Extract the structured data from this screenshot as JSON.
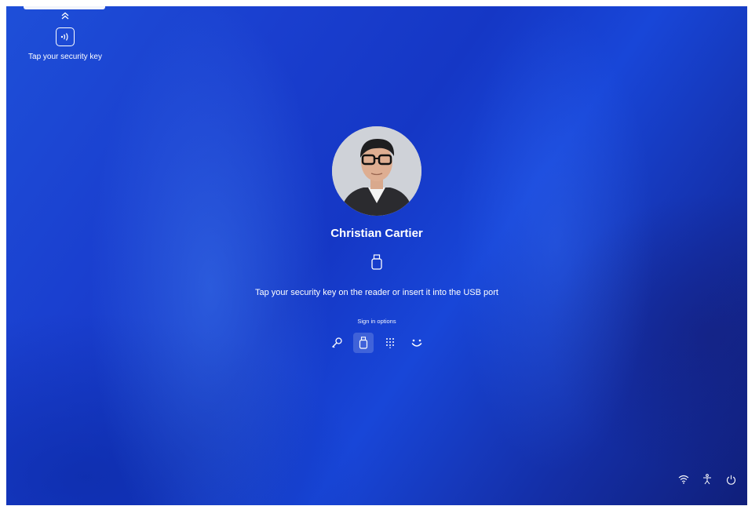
{
  "notification": {
    "label": "Tap your security key",
    "icons": {
      "expand": "chevron-double-up-icon",
      "key": "nfc-security-key-icon"
    }
  },
  "user": {
    "name": "Christian Cartier",
    "avatar_icon": "user-photo-avatar"
  },
  "prompt": {
    "icon": "usb-security-key-icon",
    "text": "Tap your security key on the reader or insert it into the USB port"
  },
  "sign_in": {
    "label": "Sign in options",
    "options": [
      {
        "icon": "key-icon",
        "selected": false
      },
      {
        "icon": "usb-key-icon",
        "selected": true
      },
      {
        "icon": "pin-keypad-icon",
        "selected": false
      },
      {
        "icon": "face-recognition-icon",
        "selected": false
      }
    ]
  },
  "tray": {
    "icons": [
      "wifi-icon",
      "accessibility-icon",
      "power-icon"
    ]
  },
  "colors": {
    "background": "#1a3fcf",
    "text": "#ffffff"
  }
}
